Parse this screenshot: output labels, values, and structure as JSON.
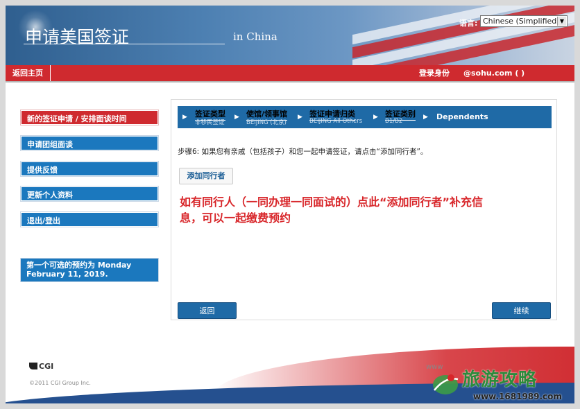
{
  "header": {
    "title": "申请美国签证",
    "title_suffix": "in China",
    "language_label": "语言:",
    "language_selected": "Chinese (Simplified)"
  },
  "topbar": {
    "home_link": "返回主页",
    "login_label": "登录身份",
    "login_value": "@sohu.com ( )"
  },
  "sidebar": {
    "items": [
      {
        "label": "新的签证申请 / 安排面谈时间",
        "active": true
      },
      {
        "label": "申请团组面谈"
      },
      {
        "label": "提供反馈"
      },
      {
        "label": "更新个人资料"
      },
      {
        "label": "退出/登出"
      }
    ],
    "appointment_note": "第一个可选的预约为 Monday February 11, 2019."
  },
  "steps": [
    {
      "title": "签证类型",
      "sub": "非移民签证"
    },
    {
      "title": "使馆/领事馆",
      "sub": "BEIJING (北京)"
    },
    {
      "title": "签证申请归类",
      "sub": "BEIJING All Others"
    },
    {
      "title": "签证类别",
      "sub": "B1/B2"
    },
    {
      "title": "Dependents",
      "sub": ""
    }
  ],
  "main": {
    "instruction": "步骤6: 如果您有亲戚（包括孩子）和您一起申请签证，请点击“添加同行者”。",
    "add_button": "添加同行者",
    "annotation": "如有同行人（一同办理一同面试的）点此“添加同行者”补充信息，可以一起缴费预约",
    "back_button": "返回",
    "next_button": "继续"
  },
  "footer": {
    "logo_text": "CGI",
    "copyright": "©2011 CGI Group Inc.",
    "www": "www"
  },
  "watermark": {
    "text": "旅游攻略",
    "url": "www.1681989.com"
  },
  "colors": {
    "brand_blue": "#1b78be",
    "brand_red": "#cf2a2f",
    "annotation_red": "#d8262a"
  }
}
